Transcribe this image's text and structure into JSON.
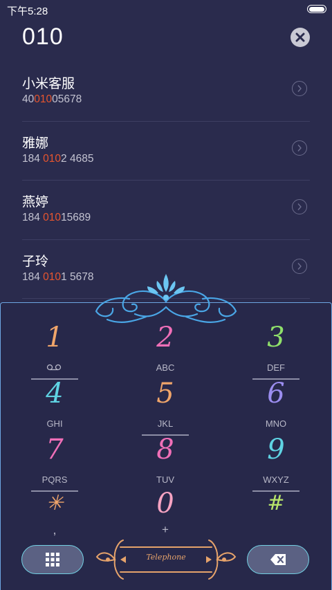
{
  "status_bar": {
    "time": "下午5:28"
  },
  "dialer": {
    "number": "010"
  },
  "results": [
    {
      "name": "小米客服",
      "pre": "40",
      "match": "010",
      "post": "05678"
    },
    {
      "name": "雅娜",
      "pre": "184 ",
      "match": "010",
      "post": "2 4685"
    },
    {
      "name": "燕婷",
      "pre": "184 ",
      "match": "010",
      "post": "15689"
    },
    {
      "name": "子玲",
      "pre": "184 ",
      "match": "010",
      "post": "1 5678"
    }
  ],
  "keypad": [
    {
      "digit": "1",
      "letters": "",
      "color": "#f0a56a"
    },
    {
      "digit": "2",
      "letters": "ABC",
      "color": "#f06fb8"
    },
    {
      "digit": "3",
      "letters": "DEF",
      "color": "#8fe06a"
    },
    {
      "digit": "4",
      "letters": "GHI",
      "color": "#5fd3e3"
    },
    {
      "digit": "5",
      "letters": "JKL",
      "color": "#f0a56a"
    },
    {
      "digit": "6",
      "letters": "MNO",
      "color": "#9b8df0"
    },
    {
      "digit": "7",
      "letters": "PQRS",
      "color": "#f06fb8"
    },
    {
      "digit": "8",
      "letters": "TUV",
      "color": "#f06fb8"
    },
    {
      "digit": "9",
      "letters": "WXYZ",
      "color": "#5fd3e3"
    },
    {
      "digit": "✳",
      "letters": ",",
      "color": "#f0a56a"
    },
    {
      "digit": "0",
      "letters": "+",
      "color": "#f6a3c2"
    },
    {
      "digit": "#",
      "letters": "",
      "color": "#b7e46a"
    }
  ],
  "call_button": {
    "label": "Telephone"
  },
  "icons": {
    "clear": "close-icon",
    "voicemail": "voicemail-icon",
    "keypad_toggle": "keypad-grid-icon",
    "backspace": "backspace-icon",
    "row_action": "chevron-right-icon"
  },
  "colors": {
    "background": "#2a2b4d",
    "match_highlight": "#e8552e",
    "accent_border": "#6da6e3",
    "pill_border": "#72d0e3",
    "ornament": "#e6a36b"
  }
}
